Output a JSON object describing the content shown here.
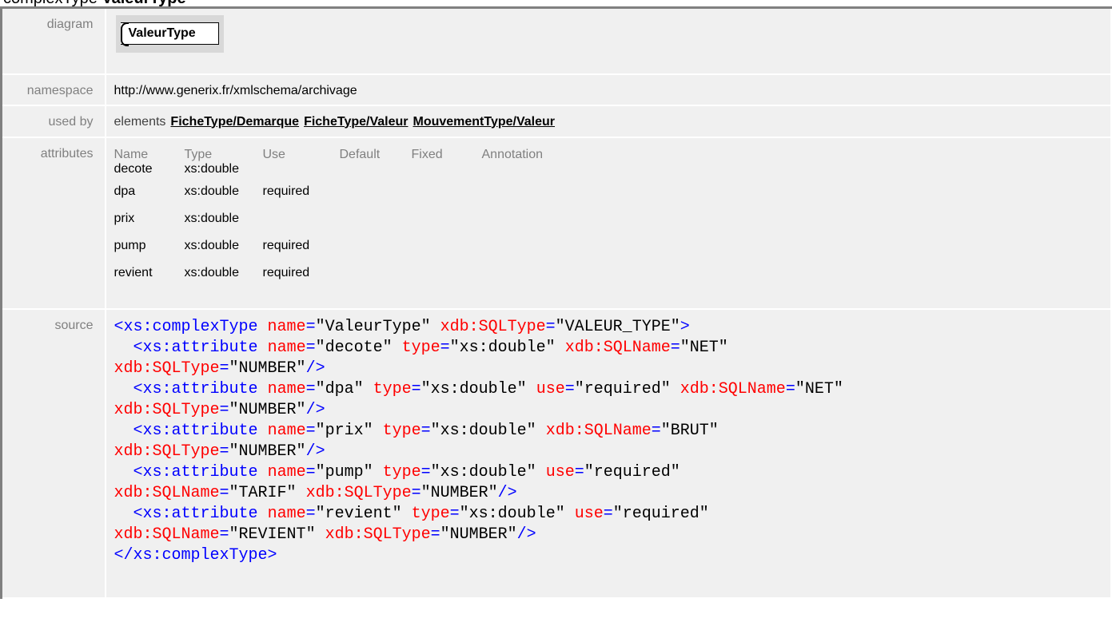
{
  "title": {
    "prefix": "complexType ",
    "name": "ValeurType"
  },
  "rows": {
    "diagram": {
      "label": "diagram",
      "type_name": "ValeurType"
    },
    "namespace": {
      "label": "namespace",
      "value": "http://www.generix.fr/xmlschema/archivage"
    },
    "used_by": {
      "label": "used by",
      "prefix": "elements",
      "links": [
        "FicheType/Demarque",
        "FicheType/Valeur",
        "MouvementType/Valeur"
      ]
    },
    "attributes": {
      "label": "attributes",
      "headers": [
        "Name",
        "Type",
        "Use",
        "Default",
        "Fixed",
        "Annotation"
      ],
      "items": [
        {
          "name": "decote",
          "type": "xs:double",
          "use": ""
        },
        {
          "name": "dpa",
          "type": "xs:double",
          "use": "required"
        },
        {
          "name": "prix",
          "type": "xs:double",
          "use": ""
        },
        {
          "name": "pump",
          "type": "xs:double",
          "use": "required"
        },
        {
          "name": "revient",
          "type": "xs:double",
          "use": "required"
        }
      ]
    },
    "source": {
      "label": "source",
      "lines": [
        [
          [
            "t",
            "<xs:complexType"
          ],
          [
            "v",
            " "
          ],
          [
            "a",
            "name"
          ],
          [
            "t",
            "="
          ],
          [
            "v",
            "\"ValeurType\""
          ],
          [
            "v",
            " "
          ],
          [
            "a",
            "xdb:SQLType"
          ],
          [
            "t",
            "="
          ],
          [
            "v",
            "\"VALEUR_TYPE\""
          ],
          [
            "t",
            ">"
          ]
        ],
        [
          [
            "v",
            "  "
          ],
          [
            "t",
            "<xs:attribute"
          ],
          [
            "v",
            " "
          ],
          [
            "a",
            "name"
          ],
          [
            "t",
            "="
          ],
          [
            "v",
            "\"decote\""
          ],
          [
            "v",
            " "
          ],
          [
            "a",
            "type"
          ],
          [
            "t",
            "="
          ],
          [
            "v",
            "\"xs:double\""
          ],
          [
            "v",
            " "
          ],
          [
            "a",
            "xdb:SQLName"
          ],
          [
            "t",
            "="
          ],
          [
            "v",
            "\"NET\""
          ]
        ],
        [
          [
            "a",
            "xdb:SQLType"
          ],
          [
            "t",
            "="
          ],
          [
            "v",
            "\"NUMBER\""
          ],
          [
            "t",
            "/>"
          ]
        ],
        [
          [
            "v",
            "  "
          ],
          [
            "t",
            "<xs:attribute"
          ],
          [
            "v",
            " "
          ],
          [
            "a",
            "name"
          ],
          [
            "t",
            "="
          ],
          [
            "v",
            "\"dpa\""
          ],
          [
            "v",
            " "
          ],
          [
            "a",
            "type"
          ],
          [
            "t",
            "="
          ],
          [
            "v",
            "\"xs:double\""
          ],
          [
            "v",
            " "
          ],
          [
            "a",
            "use"
          ],
          [
            "t",
            "="
          ],
          [
            "v",
            "\"required\""
          ],
          [
            "v",
            " "
          ],
          [
            "a",
            "xdb:SQLName"
          ],
          [
            "t",
            "="
          ],
          [
            "v",
            "\"NET\""
          ]
        ],
        [
          [
            "a",
            "xdb:SQLType"
          ],
          [
            "t",
            "="
          ],
          [
            "v",
            "\"NUMBER\""
          ],
          [
            "t",
            "/>"
          ]
        ],
        [
          [
            "v",
            "  "
          ],
          [
            "t",
            "<xs:attribute"
          ],
          [
            "v",
            " "
          ],
          [
            "a",
            "name"
          ],
          [
            "t",
            "="
          ],
          [
            "v",
            "\"prix\""
          ],
          [
            "v",
            " "
          ],
          [
            "a",
            "type"
          ],
          [
            "t",
            "="
          ],
          [
            "v",
            "\"xs:double\""
          ],
          [
            "v",
            " "
          ],
          [
            "a",
            "xdb:SQLName"
          ],
          [
            "t",
            "="
          ],
          [
            "v",
            "\"BRUT\""
          ]
        ],
        [
          [
            "a",
            "xdb:SQLType"
          ],
          [
            "t",
            "="
          ],
          [
            "v",
            "\"NUMBER\""
          ],
          [
            "t",
            "/>"
          ]
        ],
        [
          [
            "v",
            "  "
          ],
          [
            "t",
            "<xs:attribute"
          ],
          [
            "v",
            " "
          ],
          [
            "a",
            "name"
          ],
          [
            "t",
            "="
          ],
          [
            "v",
            "\"pump\""
          ],
          [
            "v",
            " "
          ],
          [
            "a",
            "type"
          ],
          [
            "t",
            "="
          ],
          [
            "v",
            "\"xs:double\""
          ],
          [
            "v",
            " "
          ],
          [
            "a",
            "use"
          ],
          [
            "t",
            "="
          ],
          [
            "v",
            "\"required\""
          ]
        ],
        [
          [
            "a",
            "xdb:SQLName"
          ],
          [
            "t",
            "="
          ],
          [
            "v",
            "\"TARIF\""
          ],
          [
            "v",
            " "
          ],
          [
            "a",
            "xdb:SQLType"
          ],
          [
            "t",
            "="
          ],
          [
            "v",
            "\"NUMBER\""
          ],
          [
            "t",
            "/>"
          ]
        ],
        [
          [
            "v",
            "  "
          ],
          [
            "t",
            "<xs:attribute"
          ],
          [
            "v",
            " "
          ],
          [
            "a",
            "name"
          ],
          [
            "t",
            "="
          ],
          [
            "v",
            "\"revient\""
          ],
          [
            "v",
            " "
          ],
          [
            "a",
            "type"
          ],
          [
            "t",
            "="
          ],
          [
            "v",
            "\"xs:double\""
          ],
          [
            "v",
            " "
          ],
          [
            "a",
            "use"
          ],
          [
            "t",
            "="
          ],
          [
            "v",
            "\"required\""
          ]
        ],
        [
          [
            "a",
            "xdb:SQLName"
          ],
          [
            "t",
            "="
          ],
          [
            "v",
            "\"REVIENT\""
          ],
          [
            "v",
            " "
          ],
          [
            "a",
            "xdb:SQLType"
          ],
          [
            "t",
            "="
          ],
          [
            "v",
            "\"NUMBER\""
          ],
          [
            "t",
            "/>"
          ]
        ],
        [
          [
            "t",
            "</xs:complexType>"
          ]
        ]
      ]
    }
  },
  "colors": {
    "tag": "#0000ff",
    "attr": "#ff0000",
    "value": "#000000",
    "label": "#808080",
    "cell_bg": "#f0f0f0"
  }
}
